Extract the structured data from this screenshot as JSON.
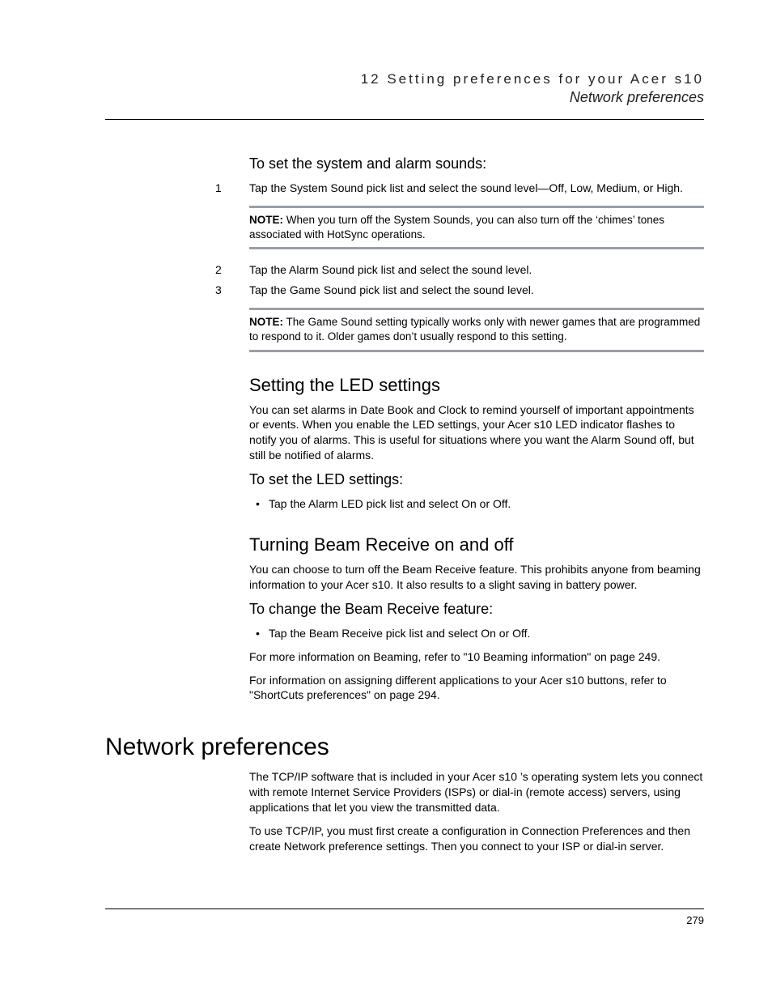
{
  "running_head": {
    "chapter": "12 Setting preferences for your Acer s10",
    "section": "Network preferences"
  },
  "sec_sounds": {
    "heading": "To set the system and alarm sounds:",
    "steps": [
      "Tap the System Sound pick list and select the sound level—Off, Low, Medium, or High.",
      "Tap the Alarm Sound pick list and select the sound level.",
      "Tap the Game Sound pick list and select the sound level."
    ],
    "note1": {
      "label": "NOTE:",
      "text": "When you turn off the System Sounds, you can also turn off the ‘chimes’ tones associated with HotSync operations."
    },
    "note2": {
      "label": "NOTE:",
      "text": "The Game Sound setting typically works only with newer games that are programmed to respond to it. Older games don’t usually respond to this setting."
    }
  },
  "sec_led": {
    "heading": "Setting the LED settings",
    "para": "You can set alarms in Date Book and Clock to remind yourself of important appointments or events. When you enable the LED settings, your Acer s10 LED indicator flashes to notify you of alarms. This is useful for situations where you want the Alarm Sound off, but still be notified of alarms.",
    "sub": "To set the LED settings:",
    "bullet": "Tap the Alarm LED pick list and select On or Off."
  },
  "sec_beam": {
    "heading": "Turning Beam Receive on and off",
    "para": "You can choose to turn off the Beam Receive feature. This prohibits anyone from beaming information to your Acer s10. It also results to a slight saving in battery power.",
    "sub": "To change the Beam Receive feature:",
    "bullet": "Tap the Beam Receive pick list and select On or Off.",
    "ref1": "For more information on Beaming, refer to \"10 Beaming information\" on page 249.",
    "ref2": "For information on assigning different applications to your Acer s10 buttons, refer to \"ShortCuts preferences\" on page 294."
  },
  "sec_network": {
    "heading": "Network preferences",
    "para1": "The TCP/IP software that is included in your Acer s10 ’s operating system lets you connect with remote Internet Service Providers (ISPs) or dial-in (remote access) servers, using applications that let you view the transmitted data.",
    "para2": "To use TCP/IP, you must first create a configuration in Connection Preferences and then create Network preference settings. Then you connect to your ISP or dial-in server."
  },
  "page_number": "279"
}
